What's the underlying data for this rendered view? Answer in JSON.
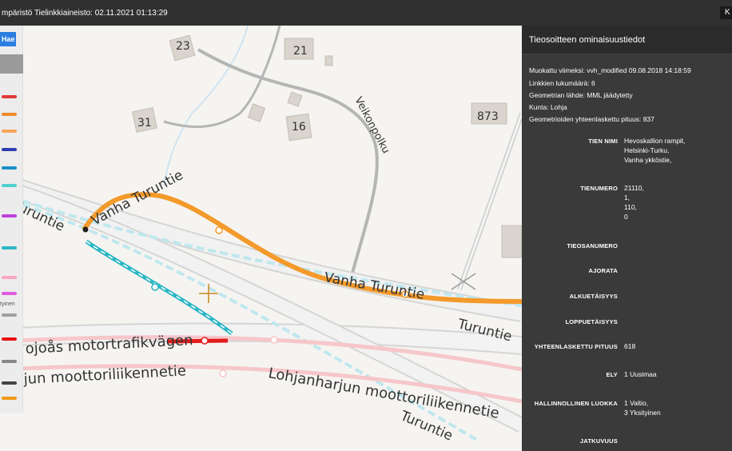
{
  "topbar": {
    "title": "mpäristö Tielinkkiaineisto: 02.11.2021 01:13:29",
    "corner_button": "K"
  },
  "legend": {
    "search_button": "Hae",
    "swatch_colors": [
      "#e23b3b",
      "#f08a2a",
      "#f5a65a",
      "#2d3fb0",
      "#1a8fc9",
      "#4fd0d0",
      "#c040e0",
      "#2fb6c8",
      "#f7a8c0",
      "#e05ae0",
      "#a0a0a0",
      "#e81010",
      "#888888",
      "#444444",
      "#f09a1a"
    ],
    "partial_label": "tyinen"
  },
  "map": {
    "building_numbers": [
      "23",
      "21",
      "31",
      "16",
      "873"
    ],
    "road_labels": [
      "Vanha Turuntie",
      "Veikonpolku",
      "Vanha Turuntie",
      "Turuntie",
      "Turuntie",
      "Turuntie",
      "ojoås motortrafikvägen",
      "jun moottoriliikennetie",
      "Lohjanharjun moottoriliikennetie"
    ],
    "cursor": "crosshair"
  },
  "panel": {
    "header": "Tieosoitteen ominaisuustiedot",
    "meta": [
      "Muokattu viimeksi: vvh_modified 09.08.2018 14:18:59",
      "Linkkien lukumäärä: 6",
      "Geometrian lähde: MML jäädytetty",
      "Kunta: Lohja",
      "Geometrioiden yhteenlaskettu pituus: 837"
    ],
    "fields": [
      {
        "label": "TIEN NIMI",
        "value": "Hevoskallion rampit,\nHelsinki-Turku,\nVanha ykköstie,"
      },
      {
        "label": "TIENUMERO",
        "value": "21110,\n1,\n110,\n0"
      },
      {
        "label": "TIEOSANUMERO",
        "value": ""
      },
      {
        "label": "AJORATA",
        "value": ""
      },
      {
        "label": "ALKUETÄISYYS",
        "value": ""
      },
      {
        "label": "LOPPUETÄISYYS",
        "value": ""
      },
      {
        "label": "YHTEENLASKETTU PITUUS",
        "value": "618"
      },
      {
        "label": "ELY",
        "value": "1 Uusimaa"
      },
      {
        "label": "HALLINNOLLINEN LUOKKA",
        "value": "1 Valtio,\n3 Yksityinen"
      },
      {
        "label": "JATKUVUUS",
        "value": ""
      }
    ]
  }
}
